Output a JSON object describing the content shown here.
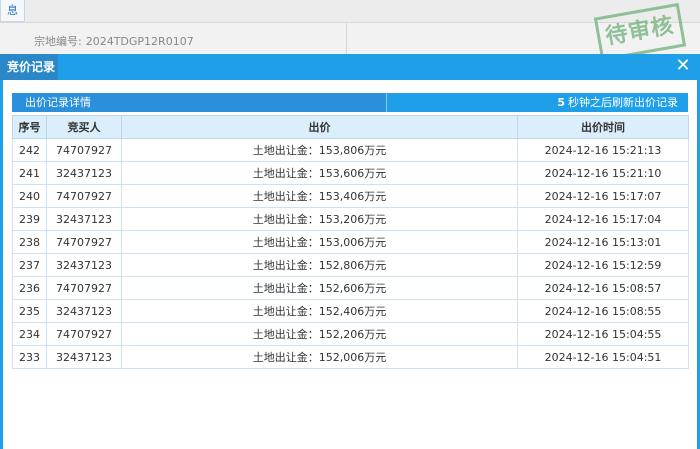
{
  "background": {
    "tab_label": "息",
    "land_label": "宗地编号:",
    "land_value": "2024TDGP12R0107",
    "stamp_text": "待审核"
  },
  "modal": {
    "title": "竞价记录",
    "close_icon": "close-icon",
    "section_title": "出价记录详情",
    "refresh_count": "5",
    "refresh_text": "秒钟之后刷新出价记录",
    "columns": [
      "序号",
      "竞买人",
      "出价",
      "出价时间"
    ],
    "rows": [
      {
        "seq": "242",
        "bidder": "74707927",
        "bid": "土地出让金：153,806万元",
        "time": "2024-12-16 15:21:13"
      },
      {
        "seq": "241",
        "bidder": "32437123",
        "bid": "土地出让金：153,606万元",
        "time": "2024-12-16 15:21:10"
      },
      {
        "seq": "240",
        "bidder": "74707927",
        "bid": "土地出让金：153,406万元",
        "time": "2024-12-16 15:17:07"
      },
      {
        "seq": "239",
        "bidder": "32437123",
        "bid": "土地出让金：153,206万元",
        "time": "2024-12-16 15:17:04"
      },
      {
        "seq": "238",
        "bidder": "74707927",
        "bid": "土地出让金：153,006万元",
        "time": "2024-12-16 15:13:01"
      },
      {
        "seq": "237",
        "bidder": "32437123",
        "bid": "土地出让金：152,806万元",
        "time": "2024-12-16 15:12:59"
      },
      {
        "seq": "236",
        "bidder": "74707927",
        "bid": "土地出让金：152,606万元",
        "time": "2024-12-16 15:08:57"
      },
      {
        "seq": "235",
        "bidder": "32437123",
        "bid": "土地出让金：152,406万元",
        "time": "2024-12-16 15:08:55"
      },
      {
        "seq": "234",
        "bidder": "74707927",
        "bid": "土地出让金：152,206万元",
        "time": "2024-12-16 15:04:55"
      },
      {
        "seq": "233",
        "bidder": "32437123",
        "bid": "土地出让金：152,006万元",
        "time": "2024-12-16 15:04:51"
      }
    ]
  },
  "colors": {
    "modal_blue": "#1e9fe8",
    "title_blue": "#2b88c8",
    "header_bg": "#daeefb",
    "stamp_green": "#6fb07a"
  }
}
